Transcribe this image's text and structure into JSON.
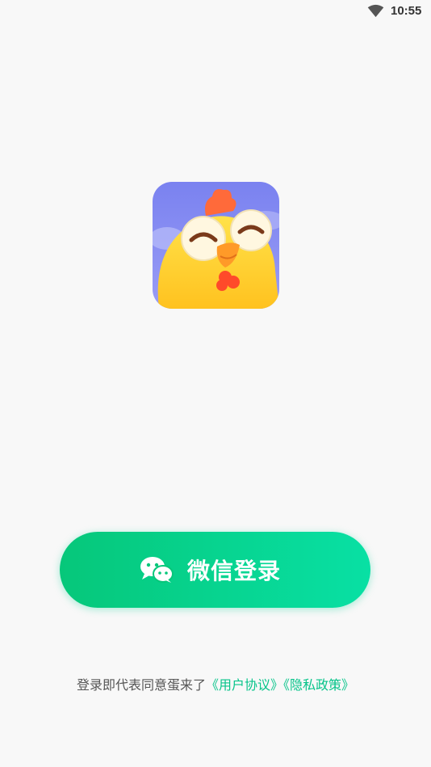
{
  "status_bar": {
    "time": "10:55",
    "wifi_icon": "wifi-icon"
  },
  "app": {
    "logo_icon": "chicken-mascot-icon"
  },
  "login": {
    "wechat_icon": "wechat-icon",
    "label": "微信登录",
    "accent_start": "#06c77a",
    "accent_end": "#08e0a4"
  },
  "agreement": {
    "prefix": "登录即代表同意蛋来了",
    "user_agreement": "《用户协议》",
    "privacy_policy": "《隐私政策》",
    "link_color": "#07c48a"
  }
}
